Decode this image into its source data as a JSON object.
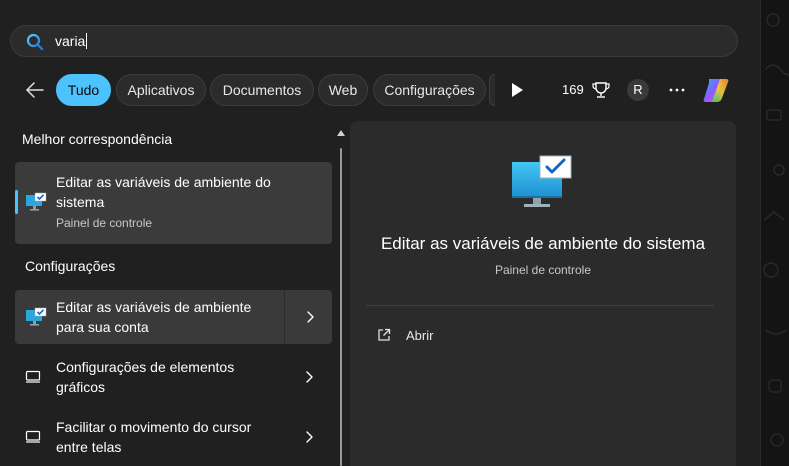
{
  "search": {
    "query": "varia"
  },
  "filters": {
    "chips": [
      "Tudo",
      "Aplicativos",
      "Documentos",
      "Web",
      "Configurações"
    ],
    "active": "Tudo",
    "points": "169",
    "avatar_initial": "R"
  },
  "results": {
    "best_match_heading": "Melhor correspondência",
    "best": {
      "title_line1": "Editar as variáveis de ambiente do",
      "title_line2": "sistema",
      "subtitle": "Painel de controle"
    },
    "settings_heading": "Configurações",
    "settings_items": [
      {
        "line1": "Editar as variáveis de ambiente",
        "line2": "para sua conta"
      },
      {
        "line1": "Configurações de elementos",
        "line2": "gráficos"
      },
      {
        "line1": "Facilitar o movimento do cursor",
        "line2": "entre telas"
      }
    ]
  },
  "preview": {
    "title": "Editar as variáveis de ambiente do sistema",
    "subtitle": "Painel de controle",
    "action_open": "Abrir"
  },
  "colors": {
    "accent": "#4cc2ff",
    "background": "#202020",
    "card": "#2b2b2b"
  },
  "icons": {
    "search": "search-icon",
    "back": "back-arrow-icon",
    "play": "play-icon",
    "trophy": "trophy-icon",
    "more": "more-icon",
    "copilot": "copilot-icon",
    "system": "monitor-check-icon",
    "display": "display-icon",
    "chevron": "chevron-right-icon",
    "open": "open-external-icon"
  }
}
